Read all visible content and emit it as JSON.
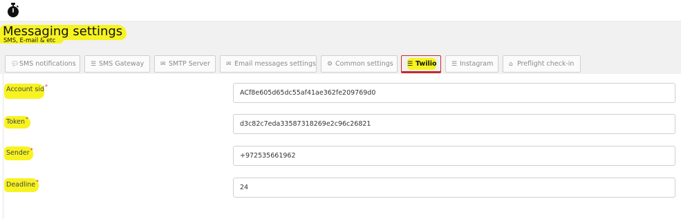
{
  "header": {
    "title": "Messaging settings",
    "subtitle": "SMS, E-mail & etc"
  },
  "tabs": [
    {
      "label": "SMS notifications",
      "icon": "chat-bubble-icon"
    },
    {
      "label": "SMS Gateway",
      "icon": "toggle-icon"
    },
    {
      "label": "SMTP Server",
      "icon": "mail-send-icon"
    },
    {
      "label": "Email messages settings",
      "icon": "envelope-icon"
    },
    {
      "label": "Common settings",
      "icon": "gear-icon"
    },
    {
      "label": "Twilio",
      "icon": "toggle-icon",
      "active": true
    },
    {
      "label": "Instagram",
      "icon": "toggle-icon"
    },
    {
      "label": "Preflight check-in",
      "icon": "home-check-icon"
    }
  ],
  "form": {
    "account_sid": {
      "label": "Account sid",
      "value": "ACf8e605d65dc55af41ae362fe209769d0"
    },
    "token": {
      "label": "Token",
      "value": "d3c82c7eda33587318269e2c96c26821"
    },
    "sender": {
      "label": "Sender",
      "value": "+972535661962"
    },
    "deadline": {
      "label": "Deadline",
      "value": "24"
    },
    "required_mark": "*"
  },
  "colors": {
    "accent": "#c52a2a",
    "highlight": "#f7f321",
    "header_bg": "#f1f1f1"
  }
}
